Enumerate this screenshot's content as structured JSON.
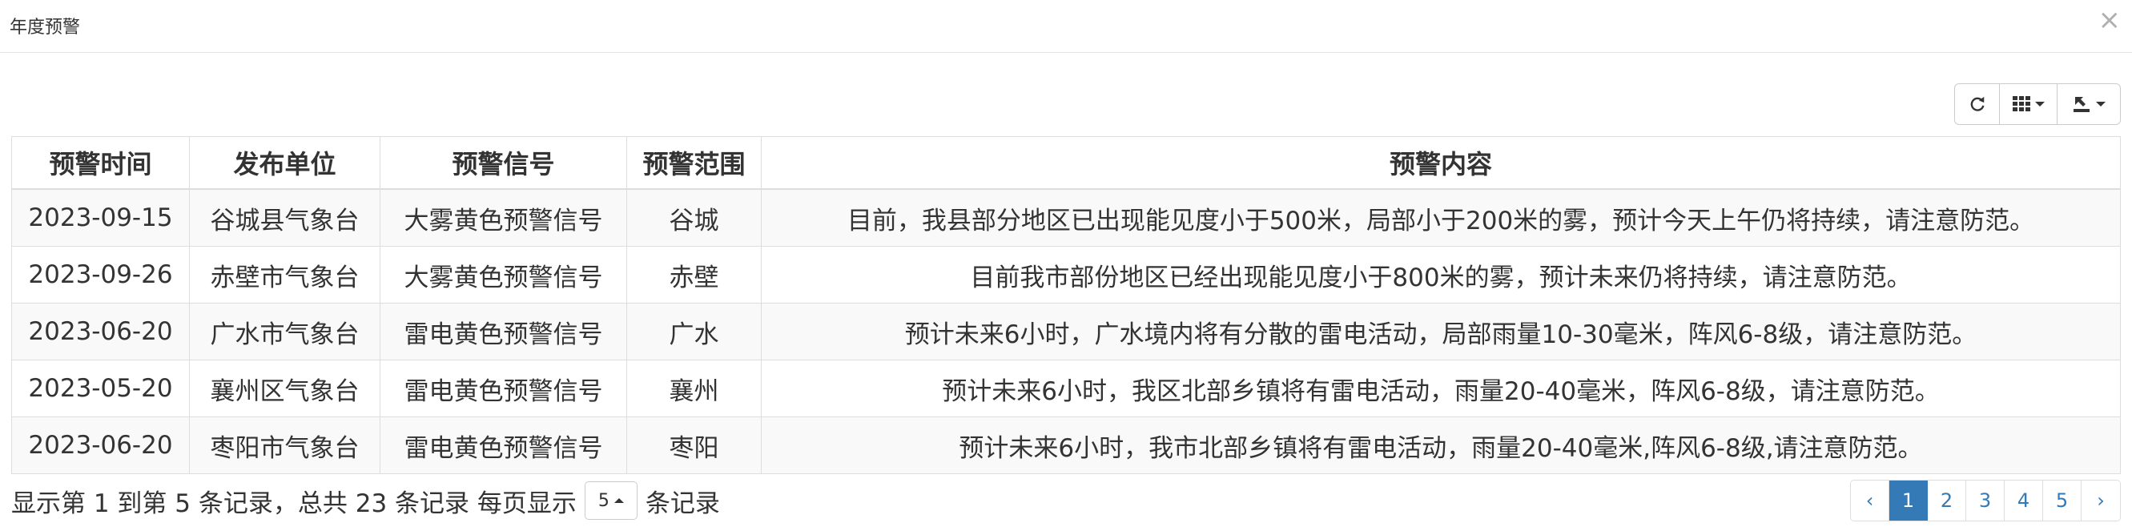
{
  "modal": {
    "title": "年度预警",
    "close_symbol": "×"
  },
  "toolbar": {
    "refresh_icon": "refresh-icon",
    "columns_icon": "grid-columns-icon",
    "export_icon": "export-icon"
  },
  "table": {
    "headers": [
      "预警时间",
      "发布单位",
      "预警信号",
      "预警范围",
      "预警内容"
    ],
    "rows": [
      [
        "2023-09-15",
        "谷城县气象台",
        "大雾黄色预警信号",
        "谷城",
        "目前，我县部分地区已出现能见度小于500米，局部小于200米的雾，预计今天上午仍将持续，请注意防范。"
      ],
      [
        "2023-09-26",
        "赤壁市气象台",
        "大雾黄色预警信号",
        "赤壁",
        "目前我市部份地区已经出现能见度小于800米的雾，预计未来仍将持续，请注意防范。"
      ],
      [
        "2023-06-20",
        "广水市气象台",
        "雷电黄色预警信号",
        "广水",
        "预计未来6小时，广水境内将有分散的雷电活动，局部雨量10-30毫米，阵风6-8级，请注意防范。"
      ],
      [
        "2023-05-20",
        "襄州区气象台",
        "雷电黄色预警信号",
        "襄州",
        "预计未来6小时，我区北部乡镇将有雷电活动，雨量20-40毫米，阵风6-8级，请注意防范。"
      ],
      [
        "2023-06-20",
        "枣阳市气象台",
        "雷电黄色预警信号",
        "枣阳",
        "预计未来6小时，我市北部乡镇将有雷电活动，雨量20-40毫米,阵风6-8级,请注意防范。"
      ]
    ]
  },
  "pagination": {
    "info_prefix": "显示第 1 到第 5 条记录，总共 23 条记录 每页显示",
    "page_size": "5",
    "info_suffix": "条记录",
    "prev": "‹",
    "next": "›",
    "pages": [
      "1",
      "2",
      "3",
      "4",
      "5"
    ],
    "current_page": "1"
  },
  "colors": {
    "accent": "#337ab7",
    "border": "#dddddd",
    "stripe": "#f9f9f9"
  }
}
